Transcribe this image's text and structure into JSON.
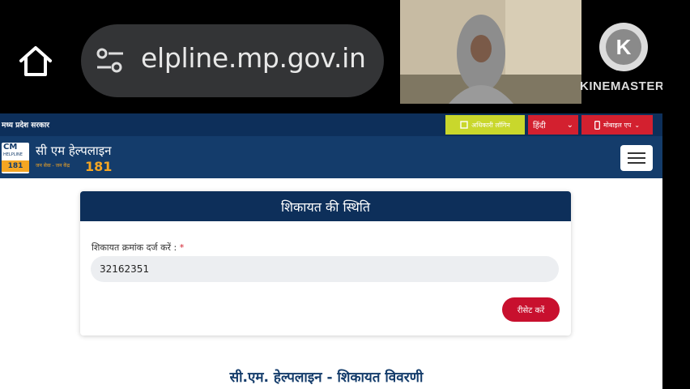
{
  "browser": {
    "url": "elpline.mp.gov.in"
  },
  "watermark": {
    "brand": "KINEMASTER"
  },
  "site": {
    "gov_label": "मध्य प्रदेश सरकार",
    "officer_login": "अधिकारी लॉगिन",
    "language": "हिंदी",
    "mobile_app": "मोबाइल एप",
    "logo": {
      "cm": "CM",
      "helpline": "HELPLINE",
      "number": "181"
    },
    "brand_title": "सी एम हेल्पलाइन",
    "tagline": "जन सेवा - जन केंद्र",
    "brand_number": "181"
  },
  "status_card": {
    "title": "शिकायत की स्थिति",
    "field_label": "शिकायत क्रमांक दर्ज करें :",
    "required_mark": "*",
    "complaint_number": "32162351",
    "reset_label": "रीसेट करें"
  },
  "details_heading": "सी.एम. हेल्पलाइन - शिकायत विवरणी"
}
